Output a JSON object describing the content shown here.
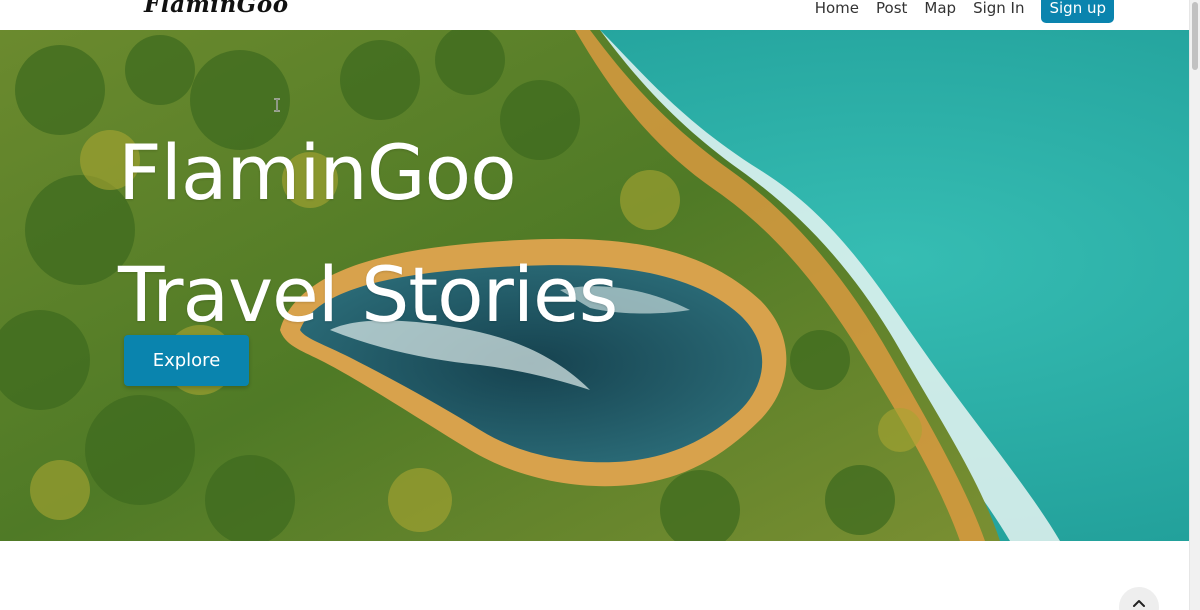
{
  "nav": {
    "logo_text": "FlaminGoo",
    "links": [
      {
        "label": "Home"
      },
      {
        "label": "Post"
      },
      {
        "label": "Map"
      },
      {
        "label": "Sign In"
      }
    ],
    "signup_label": "Sign up"
  },
  "hero": {
    "title_line1": "FlaminGoo",
    "title_line2": "Travel Stories",
    "explore_label": "Explore",
    "background_icon": "aerial-coast-image"
  },
  "colors": {
    "accent": "#0a84ae",
    "sea": "#2fb3a9",
    "foliage": "#5f8a2a",
    "cliff": "#d9a04a"
  },
  "back_to_top_icon": "chevron-up-icon"
}
